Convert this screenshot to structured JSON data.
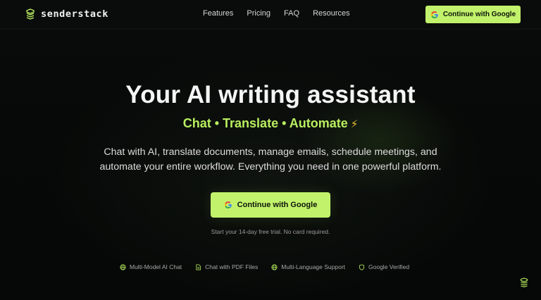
{
  "brand": {
    "name": "senderstack",
    "icon": "layers-icon"
  },
  "nav": {
    "links": [
      "Features",
      "Pricing",
      "FAQ",
      "Resources"
    ],
    "cta_label": "Continue with Google"
  },
  "hero": {
    "title": "Your AI writing assistant",
    "subtitle": "Chat • Translate • Automate",
    "subtitle_icon": "⚡",
    "description_line1": "Chat with AI, translate documents, manage emails, schedule meetings, and",
    "description_line2": "automate your entire workflow. Everything you need in one powerful platform.",
    "cta_label": "Continue with Google",
    "trial_note": "Start your 14-day free trial. No card required."
  },
  "features": [
    {
      "label": "Multi-Model AI Chat",
      "icon": "globe-icon"
    },
    {
      "label": "Chat with PDF Files",
      "icon": "document-icon"
    },
    {
      "label": "Multi-Language Support",
      "icon": "globe-icon"
    },
    {
      "label": "Google Verified",
      "icon": "shield-icon"
    }
  ],
  "colors": {
    "accent": "#c2f26b",
    "subtitle": "#b9ef5f",
    "background": "#060807"
  }
}
